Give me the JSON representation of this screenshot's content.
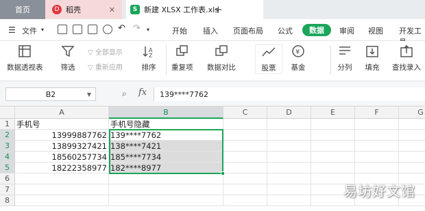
{
  "tabs": {
    "home": "首页",
    "daoke": "稻壳",
    "daoke_logo": "D",
    "file": "新建 XLSX 工作表.xls",
    "file_logo": "S",
    "close": "✕",
    "new_tab": "+"
  },
  "menu": {
    "file": "文件",
    "items": [
      "开始",
      "插入",
      "页面布局",
      "公式",
      "数据",
      "审阅",
      "视图",
      "开发工具"
    ],
    "active": "数据"
  },
  "ribbon": {
    "pivot": "数据透视表",
    "filter": "筛选",
    "show_all": "全部显示",
    "reapply": "重新应用",
    "sort": "排序",
    "duplicates": "重复项",
    "compare": "数据对比",
    "stocks": "股票",
    "fund": "基金",
    "split": "分列",
    "fill": "填充",
    "lookup": "查找录入"
  },
  "formula_bar": {
    "name_box": "B2",
    "zoom_icon": "search-icon",
    "fx": "fx",
    "value": "139****7762"
  },
  "sheet": {
    "columns": [
      "A",
      "B",
      "C",
      "D",
      "E",
      "F",
      "G"
    ],
    "rows": [
      "1",
      "2",
      "3",
      "4",
      "5",
      "6",
      "7",
      "8"
    ],
    "cells": {
      "A1": "手机号",
      "B1": "手机号隐藏",
      "A2": "13999887762",
      "B2": "139****7762",
      "A3": "13899327421",
      "B3": "138****7421",
      "A4": "18560257734",
      "B4": "185****7734",
      "A5": "18222358977",
      "B5": "182****8977"
    }
  },
  "watermark": "易坊好文馆",
  "colors": {
    "accent": "#1aa55a",
    "tab_home": "#8a9099",
    "tab_daoke": "#f6d9db"
  }
}
